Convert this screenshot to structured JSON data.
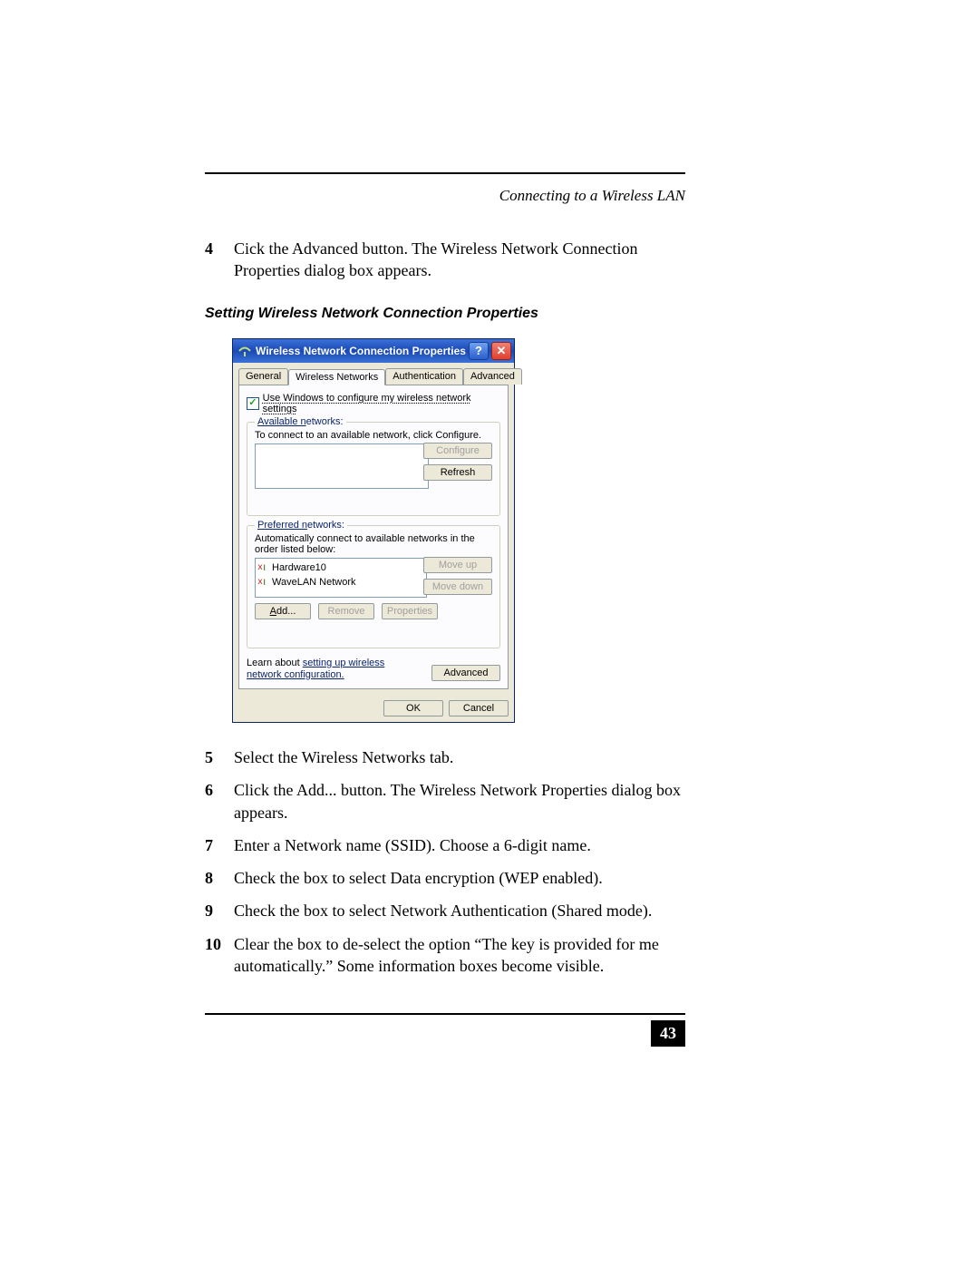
{
  "header": {
    "section_title": "Connecting to a Wireless LAN"
  },
  "steps_a": [
    {
      "n": "4",
      "text": "Cick the Advanced button. The Wireless Network Connection Properties dialog box appears."
    }
  ],
  "figure_caption": "Setting Wireless Network Connection Properties",
  "dialog": {
    "title": "Wireless Network Connection Properties",
    "help_btn": "?",
    "close_btn": "✕",
    "tabs": {
      "general": "General",
      "wireless": "Wireless Networks",
      "auth": "Authentication",
      "advanced": "Advanced"
    },
    "checkbox_label": "Use Windows to configure my wireless network settings",
    "available": {
      "legend": "Available networks:",
      "hint": "To connect to an available network, click Configure.",
      "btn_configure": "Configure",
      "btn_refresh": "Refresh"
    },
    "preferred": {
      "legend": "Preferred networks:",
      "hint": "Automatically connect to available networks in the order listed below:",
      "items": [
        "Hardware10",
        "WaveLAN Network"
      ],
      "btn_moveup": "Move up",
      "btn_movedown": "Move down",
      "btn_add": "Add...",
      "btn_remove": "Remove",
      "btn_properties": "Properties"
    },
    "learn_prefix": "Learn about ",
    "learn_link": "setting up wireless network configuration.",
    "btn_advanced": "Advanced",
    "btn_ok": "OK",
    "btn_cancel": "Cancel"
  },
  "steps_b": [
    {
      "n": "5",
      "text": "Select the Wireless Networks tab."
    },
    {
      "n": "6",
      "text": "Click the Add... button. The Wireless Network Properties dialog box appears."
    },
    {
      "n": "7",
      "text": "Enter a Network name (SSID). Choose a 6-digit name."
    },
    {
      "n": "8",
      "text": "Check the box to select Data encryption (WEP enabled)."
    },
    {
      "n": "9",
      "text": "Check the box to select Network Authentication (Shared mode)."
    },
    {
      "n": "10",
      "text": "Clear the box to de-select the option “The key is provided for me automatically.” Some information boxes become visible."
    }
  ],
  "page_number": "43"
}
